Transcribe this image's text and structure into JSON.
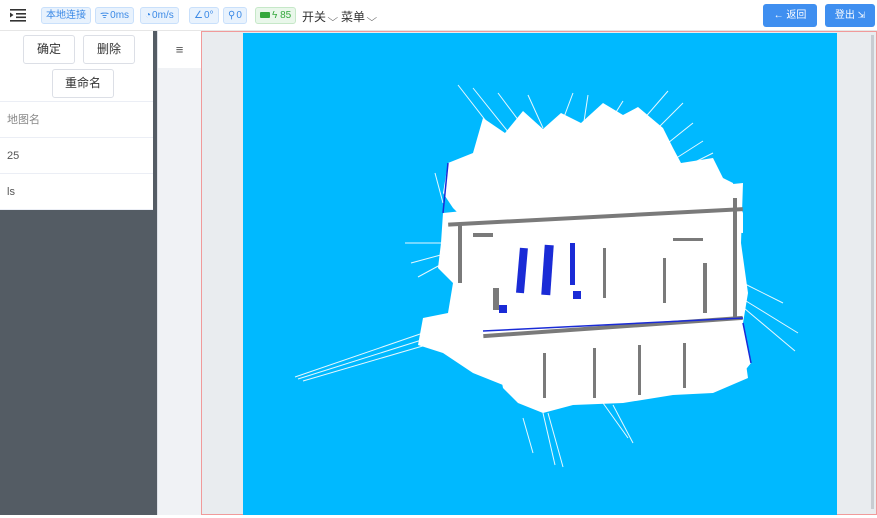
{
  "topbar": {
    "connection": "本地连接",
    "latency": "0ms",
    "speed": "0m/s",
    "angle": "0°",
    "location": "0",
    "battery": "85",
    "switch_menu": "开关",
    "main_menu": "菜单",
    "back_button": "返回",
    "logout_button": "登出"
  },
  "map_panel": {
    "confirm_button": "确定",
    "delete_button": "删除",
    "rename_button": "重命名",
    "table_header": "地图名",
    "maps": [
      "25",
      "ls"
    ]
  },
  "colors": {
    "accent": "#3f8ff0",
    "map_background": "#00b9ff",
    "sidebar": "#545c64"
  }
}
